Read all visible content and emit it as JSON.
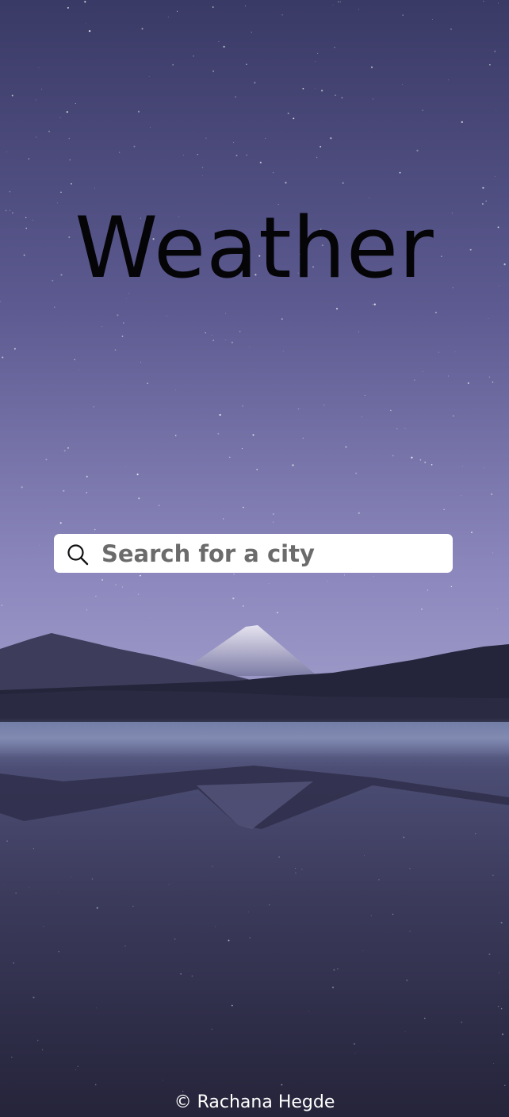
{
  "app": {
    "title": "Weather"
  },
  "search": {
    "placeholder": "Search for a city",
    "value": "",
    "icon": "search-icon"
  },
  "footer": {
    "text": "© Rachana Hegde"
  },
  "colors": {
    "sky_top": "#3a3a66",
    "sky_bottom": "#8d89bf",
    "title": "#050508",
    "search_background": "#ffffff",
    "placeholder": "#6b6b6b",
    "footer_text": "#ffffff"
  }
}
